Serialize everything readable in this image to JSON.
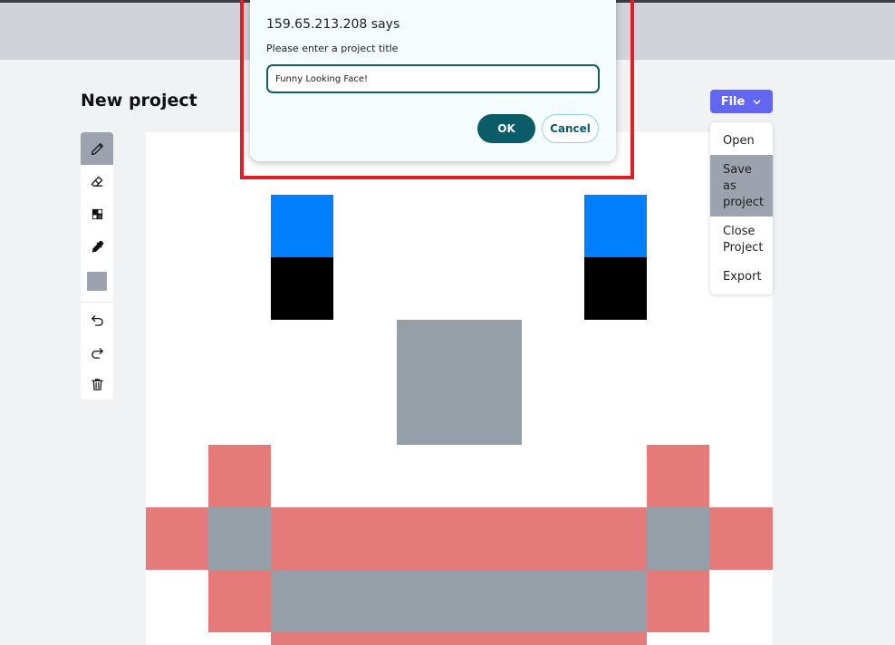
{
  "dialog": {
    "origin_title": "159.65.213.208 says",
    "message": "Please enter a project title",
    "input_value": "Funny Looking Face!",
    "ok_label": "OK",
    "cancel_label": "Cancel"
  },
  "project": {
    "title": "New project"
  },
  "file_menu": {
    "button_label": "File",
    "items": [
      {
        "label": "Open",
        "highlighted": false
      },
      {
        "label": "Save as project",
        "highlighted": true
      },
      {
        "label": "Close Project",
        "highlighted": false
      },
      {
        "label": "Export",
        "highlighted": false
      }
    ]
  },
  "toolbar": {
    "tools": [
      {
        "icon": "pencil-icon",
        "active": true
      },
      {
        "icon": "eraser-icon",
        "active": false
      },
      {
        "icon": "fill-icon",
        "active": false
      },
      {
        "icon": "eyedropper-icon",
        "active": false
      },
      {
        "icon": "color-swatch",
        "active": false
      },
      {
        "icon": "undo-icon",
        "active": false
      },
      {
        "icon": "redo-icon",
        "active": false
      },
      {
        "icon": "trash-icon",
        "active": false
      }
    ],
    "current_color": "#9ca3af"
  },
  "colors": {
    "accent": "#6366f1",
    "dialog_primary": "#0b5c69",
    "highlight_frame": "#e01e26",
    "pixel_blue": "#007fff",
    "pixel_black": "#000000",
    "pixel_gray": "#959fa8",
    "pixel_red": "#e47b7a"
  }
}
